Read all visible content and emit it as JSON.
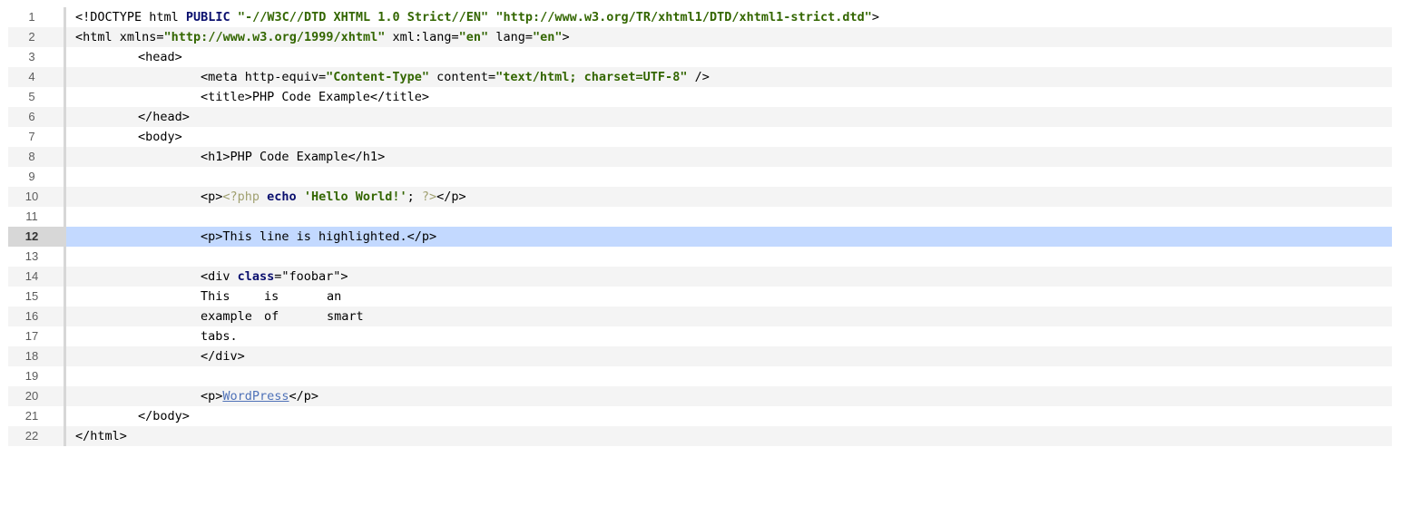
{
  "line_numbers": [
    "1",
    "2",
    "3",
    "4",
    "5",
    "6",
    "7",
    "8",
    "9",
    "10",
    "11",
    "12",
    "13",
    "14",
    "15",
    "16",
    "17",
    "18",
    "19",
    "20",
    "21",
    "22"
  ],
  "highlighted_line": "12",
  "lines": {
    "l1": {
      "a": "<!DOCTYPE html ",
      "b": "PUBLIC",
      "c": " ",
      "d": "\"-//W3C//DTD XHTML 1.0 Strict//EN\"",
      "e": " ",
      "f": "\"http://www.w3.org/TR/xhtml1/DTD/xhtml1-strict.dtd\"",
      "g": ">"
    },
    "l2": {
      "a": "<html xmlns=",
      "b": "\"http://www.w3.org/1999/xhtml\"",
      "c": " xml:lang=",
      "d": "\"en\"",
      "e": " lang=",
      "f": "\"en\"",
      "g": ">"
    },
    "l3": {
      "a": "<head>"
    },
    "l4": {
      "a": "<meta http-equiv=",
      "b": "\"Content-Type\"",
      "c": " content=",
      "d": "\"text/html; charset=UTF-8\"",
      "e": " />"
    },
    "l5": {
      "a": "<title>PHP Code Example</title>"
    },
    "l6": {
      "a": "</head>"
    },
    "l7": {
      "a": "<body>"
    },
    "l8": {
      "a": "<h1>PHP Code Example</h1>"
    },
    "l10": {
      "a": "<p>",
      "b": "<?php",
      "c": " ",
      "d": "echo",
      "e": " ",
      "f": "'Hello World!'",
      "g": "; ",
      "h": "?>",
      "i": "</p>"
    },
    "l12": {
      "a": "<p>This line is highlighted.</p>"
    },
    "l14": {
      "a": "<div ",
      "b": "class",
      "c": "=\"foobar\">"
    },
    "l15": {
      "a": "This",
      "b": "is",
      "c": "an"
    },
    "l16": {
      "a": "example",
      "b": "of",
      "c": "smart"
    },
    "l17": {
      "a": "tabs."
    },
    "l18": {
      "a": "</div>"
    },
    "l20": {
      "a": "<p>",
      "b": "WordPress",
      "c": "</p>"
    },
    "l21": {
      "a": "</body>"
    },
    "l22": {
      "a": "</html>"
    }
  },
  "colors": {
    "string": "#336600",
    "keyword": "#0a0f6e",
    "php_tag": "#a0a070",
    "link": "#4f72b8",
    "highlight_background": "#c3d9ff",
    "alternate_row_background": "#f4f4f4"
  }
}
